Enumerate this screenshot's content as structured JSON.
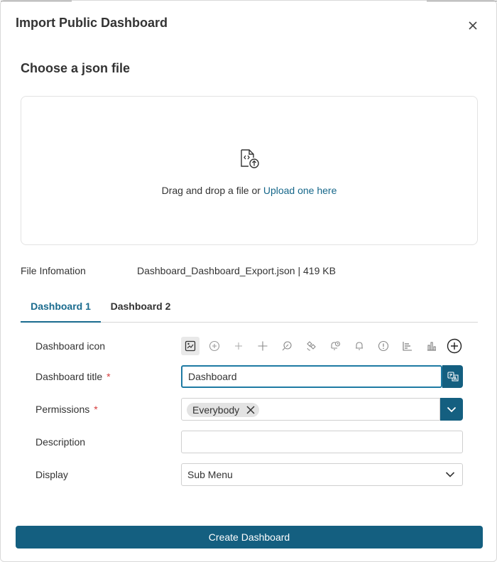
{
  "dialog": {
    "title": "Import Public Dashboard"
  },
  "upload": {
    "section_title": "Choose a json file",
    "drag_text": "Drag and drop a file or ",
    "link_text": "Upload one here"
  },
  "file_info": {
    "label": "File Infomation",
    "value": "Dashboard_Dashboard_Export.json | 419 KB"
  },
  "tabs": [
    {
      "label": "Dashboard 1",
      "active": true
    },
    {
      "label": "Dashboard 2",
      "active": false
    }
  ],
  "form": {
    "icon_label": "Dashboard icon",
    "icons": [
      "dashboard-image-icon",
      "plus-circle-icon",
      "plus-thin-icon",
      "plus-icon",
      "rocket-icon",
      "satellite-icon",
      "bell-clock-icon",
      "bell-icon",
      "alert-circle-icon",
      "bar-chart-horizontal-icon",
      "bar-chart-icon",
      "add-circle-icon"
    ],
    "title_label": "Dashboard title",
    "title_value": "Dashboard",
    "permissions_label": "Permissions",
    "permissions_chip": "Everybody",
    "description_label": "Description",
    "description_value": "",
    "display_label": "Display",
    "display_value": "Sub Menu",
    "required_mark": "*"
  },
  "actions": {
    "create_label": "Create Dashboard"
  },
  "colors": {
    "primary": "#145f80",
    "link": "#16678a",
    "required": "#d63b3b"
  }
}
